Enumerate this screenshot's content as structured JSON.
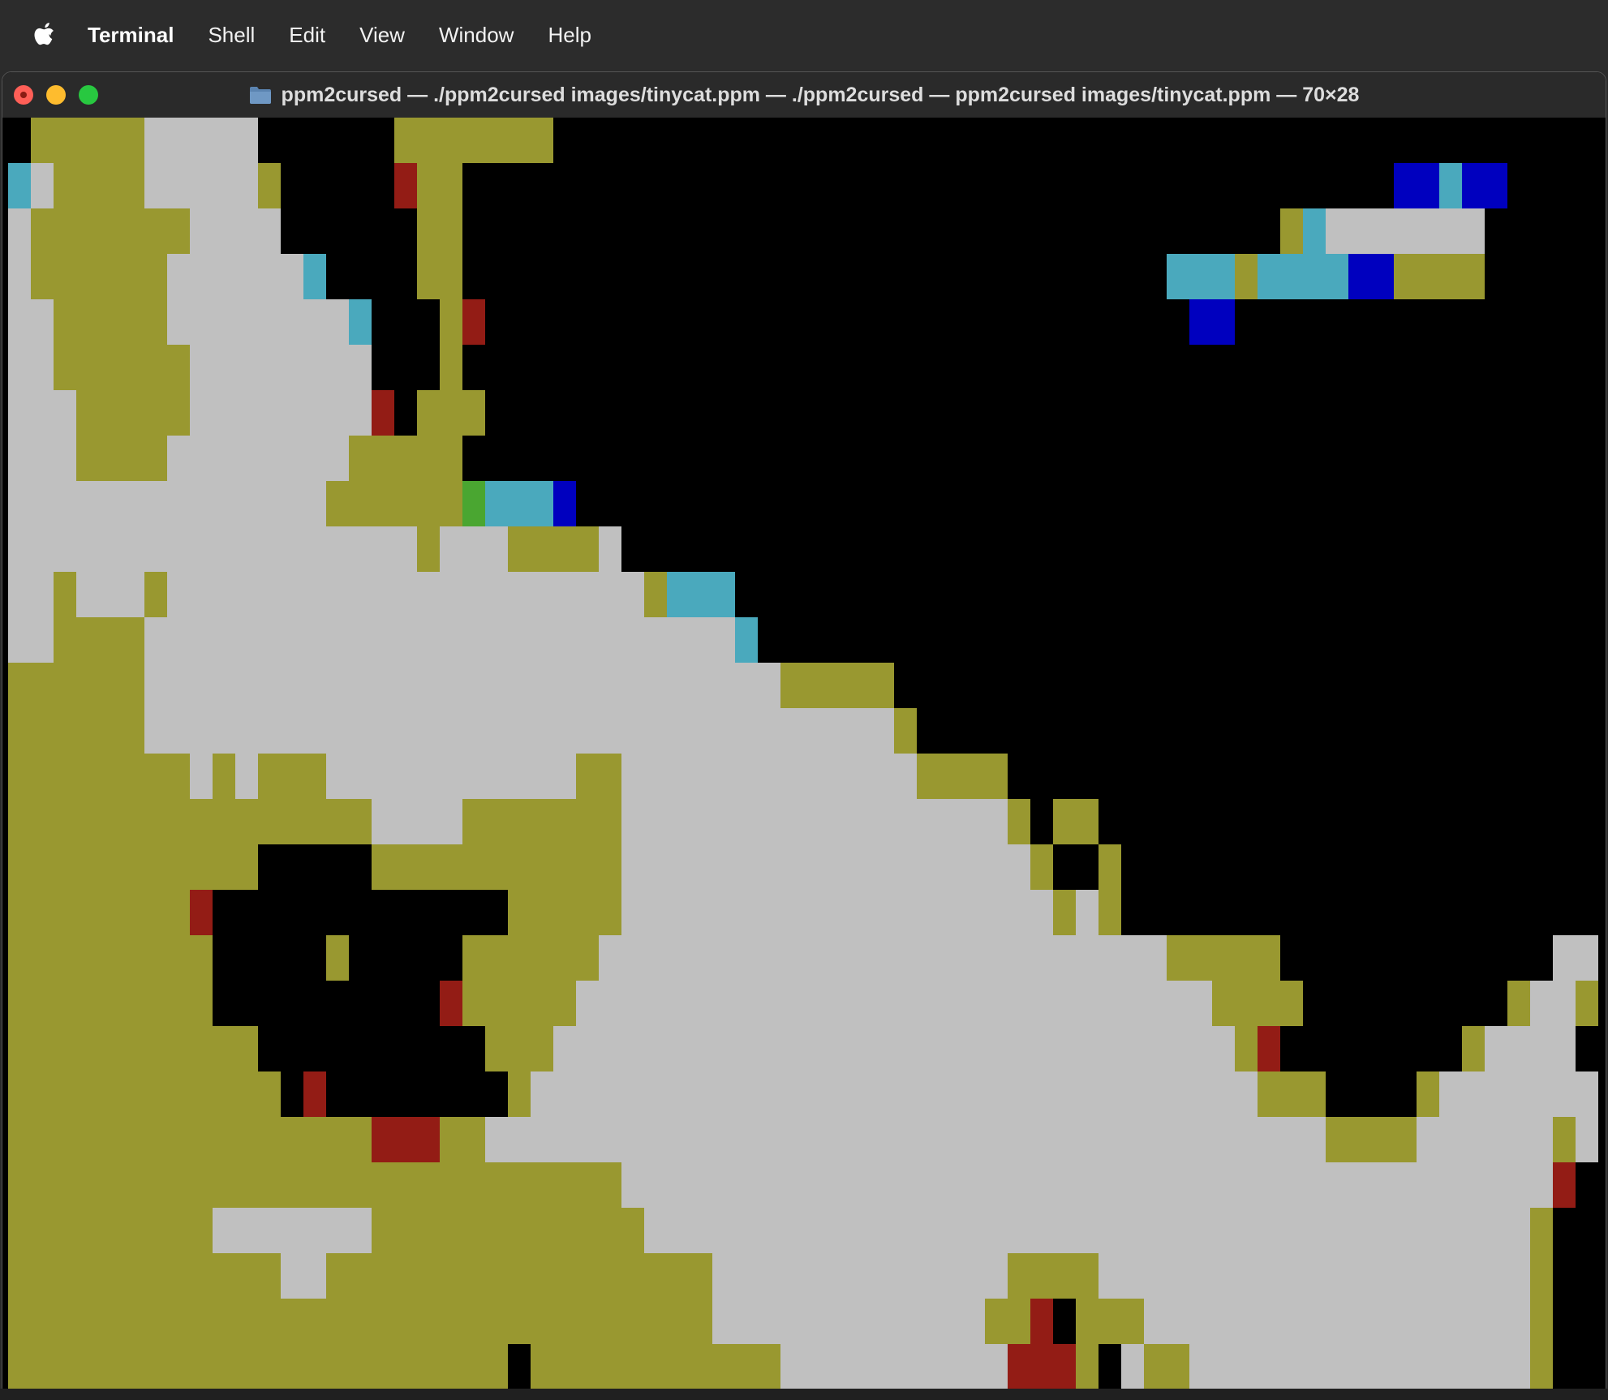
{
  "menubar": {
    "apple_icon": "apple-logo-icon",
    "app_name": "Terminal",
    "items": [
      "Shell",
      "Edit",
      "View",
      "Window",
      "Help"
    ]
  },
  "window": {
    "title": "ppm2cursed — ./ppm2cursed images/tinycat.ppm — ./ppm2cursed — ppm2cursed images/tinycat.ppm — 70×28",
    "folder_icon": "folder-icon",
    "colors": {
      "close": "#ff5f57",
      "minimize": "#febc2e",
      "zoom": "#28c840"
    }
  },
  "terminal": {
    "grid_size": "70×28",
    "image_name": "tinycat.ppm",
    "palette": {
      "k": "#000000",
      "w": "#c0c0c0",
      "o": "#999830",
      "r": "#931c15",
      "c": "#4aa9bd",
      "b": "#0000bf",
      "g": "#4aa631",
      "s": "#a8a8a8"
    },
    "rows": [
      "kooooowwwwwkkkkkkoooooookkkkkkkkkkkkkkkkkkkkkkkkkkkkkkkkkkkkkkkkkkkkkkk",
      "cwoooowwwwwokkkkkrookkkkkkkkkkkkkkkkkkkkkkkkkkkkkkkkkkkkkkkkkbbcbbkkkkk",
      "wooooooowwwwkkkkkkookkkkkkkkkkkkkkkkkkkkkkkkkkkkkkkkkkkkocwwwwwwwkkkkkk",
      "woooooowwwwwwckkkkookkkkkkkkkkkkkkkkkkkkkkkkkkkkkkkcccoccccbbooookkkkkk",
      "wwooooowwwwwwwwckkkorkkkkkkkkkkkkkkkkkkkkkkkkkkkkkkkbbkkkkkkkkkkkkkkkkkk",
      "wwoooooowwwwwwwwkkkokkkkkkkkkkkkkkkkkkkkkkkkkkkkkkkkkkkkkkkkkkkkkkkkkkkk",
      "wwwooooowwwwwwwwrkoookkkkkkkkkkkkkkkkkkkkkkkkkkkkkkkkkkkkkkkkkkkkkkkkkkk",
      "wwwoooowwwwwwwwoooookkkkkkkkkkkkkkkkkkkkkkkkkkkkkkkkkkkkkkkkkkkkkkkkkkkk",
      "wwwwwwwwwwwwwwoooooogcccbkkkkkkkkkkkkkkkkkkkkkkkkkkkkkkkkkkkkkkkkkkkkkkk",
      "wwwwwwwwwwwwwwwwwwowwwoooowkkkkkkkkkkkkkkkkkkkkkkkkkkkkkkkkkkkkkkkkkkkkk",
      "wwowwwowwwwwwwwwwwwwwwwwwwwwoccckkkkkkkkkkkkkkkkkkkkkkkkkkkkkkkkkkkkkkkk",
      "wwoooowwwwwwwwwwwwwwwwwwwwwwwwwwckkkkkkkkkkkkkkkkkkkkkkkkkkkkkkkkkkkkkkk",
      "oooooowwwwwwwwwwwwwwwwwwwwwwwwwwwwoooookkkkkkkkkkkkkkkkkkkkkkkkkkkkkkkkk",
      "oooooowwwwwwwwwwwwwwwwwwwwwwwwwwwwwwwwwokkkkkkkkkkkkkkkkkkkkkkkkkkkkkkkk",
      "oooooooowowooowwwwwwwwwwwoowwwwwwwwwwwwwooookkkkkkkkkkkkkkkkkkkkkkkkkkkk",
      "oooooooooooooooowwwwooooooowwwwwwwwwwwwwwwwwokookkkkkkkkkkkkkkkkkkkkkkkk",
      "oooooooooookkkkkooooooooooowwwwwwwwwwwwwwwwwwokkokkkkkkkkkkkkkkkkkkkkkkk",
      "oooooooorkkkkkkkkkkkkkooooowwwwwwwwwwwwwwwwwwwowoukkkkkkkkkkkkkkkkkkkkkk",
      "oooooooookkkkkokkkkkoooooowwwwwwwwwwwwwwwwwwwwwwwwwoooookkkkkkkkkkkkwwkk",
      "oooooooookkkkkkkkkkrooooowwwwwwwwwwwwwwwwwwwwwwwwwwwwooookkkkkkkkkowwok",
      "oooooooooookkkkkkkkkkooowwwwwwwwwwwwwwwwwwwwwwwwwwwwwworkkkkkkkkowwwwk",
      "ooooooooooookrkkkkkkkkowwwwwwwwwwwwwwwwwwwwwwwwwwwwwwwwoookkkkowwwwwwwk",
      "oooooooooooooooorrroowwwwwwwwwwwwwwwwwwwwwwwwwwwwwwwwwwwwwoooowwwwwwowk",
      "ooooooooooooooooooooooooooowwwwwwwwwwwwwwwwwwwwwwwwwwwwwwwwwwwwwwwwwrk",
      "ooooooooowwwwwwwoooooooooooowwwwwwwwwwwwwwwwwwwwwwwwwwwwwwwwwwwwwwwokk",
      "oooooooooooowwooooooooooooooooowwwwwwwwwwwwwoooowwwwwwwwwwwwwwwwwwwokkk",
      "ooooooooooooooooooooooooooooooowwwwwwwwwwwwoorkooowwwwwwwwwwwwwwwwwokkk",
      "ooooooooooooooooooooookooooooooooowwwwwwwwwwrrrokwoowwwwwwwwwwwwwwwokkkk"
    ]
  }
}
